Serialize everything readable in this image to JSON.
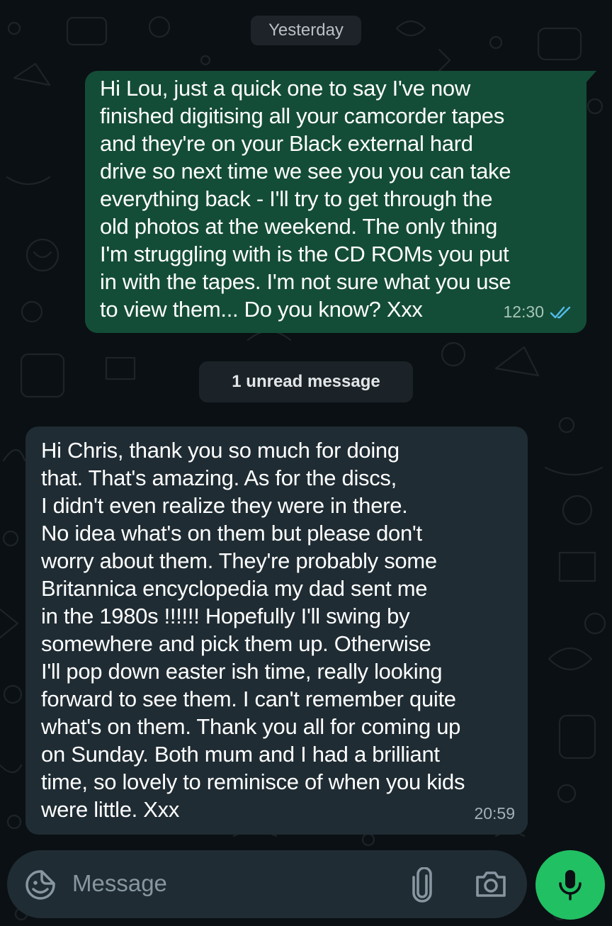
{
  "chat": {
    "date_separator": "Yesterday",
    "unread_notice": "1 unread message",
    "messages": [
      {
        "direction": "outgoing",
        "text": "Hi Lou, just a quick one to say I've now\nfinished digitising all your camcorder tapes\nand they're on your Black external hard\ndrive so next time we see you you can take\neverything back - I'll try to get through the\nold photos at the weekend. The only thing\nI'm struggling with is the CD ROMs you put\nin with the tapes. I'm not sure what you use\nto view them... Do you know? Xxx",
        "time": "12:30",
        "status_icon": "double-check-read"
      },
      {
        "direction": "incoming",
        "text": "Hi Chris, thank you so much for doing\nthat. That's amazing. As for the discs,\nI didn't even realize they were in there.\nNo idea what's on them but please don't\nworry about them. They're probably some\nBritannica encyclopedia my dad sent me\nin the 1980s !!!!!! Hopefully I'll swing by\nsomewhere and pick them up. Otherwise\nI'll pop down easter ish time, really looking\nforward to see them. I can't remember quite\nwhat's on them. Thank you all for coming up\non Sunday. Both mum and I had a brilliant\ntime, so lovely to reminisce of when you kids\nwere little. Xxx",
        "time": "20:59"
      }
    ]
  },
  "composer": {
    "placeholder": "Message",
    "icons": [
      "sticker-icon",
      "attach-icon",
      "camera-icon",
      "mic-icon"
    ]
  },
  "colors": {
    "background": "#0b1014",
    "outgoing_bubble": "#144d37",
    "incoming_bubble": "#1f2c33",
    "read_ticks": "#53bdeb",
    "mic_button": "#21c063",
    "icon_gray": "#8796a0"
  }
}
